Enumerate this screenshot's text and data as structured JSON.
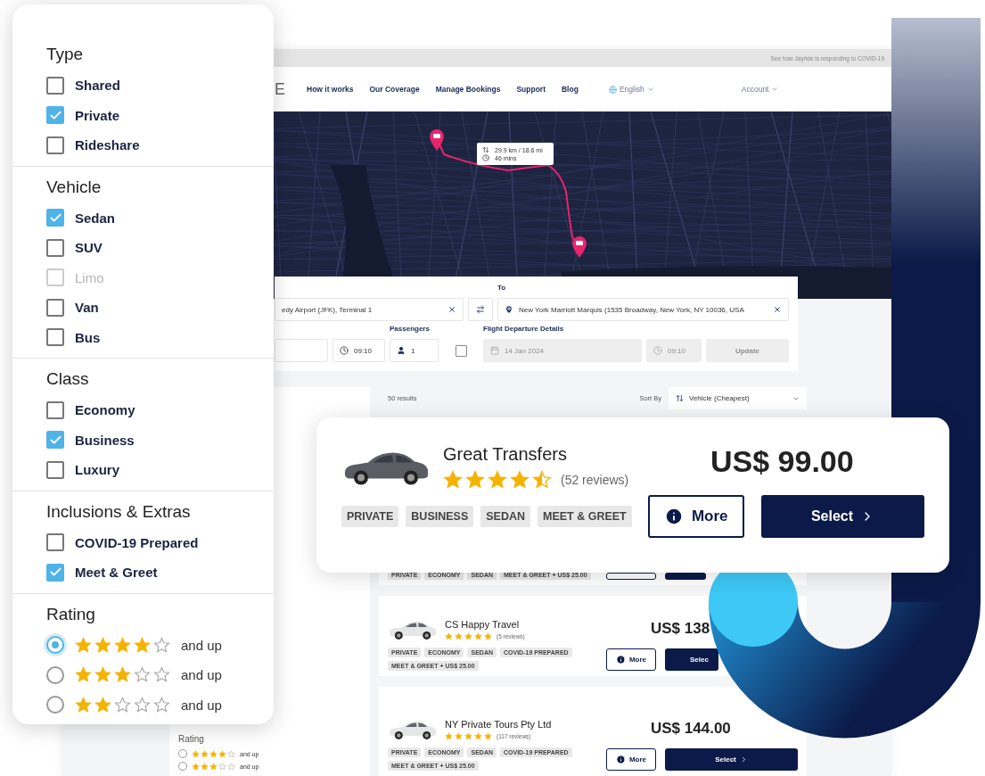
{
  "filters": {
    "sections": [
      {
        "title": "Type",
        "kind": "checkbox",
        "options": [
          {
            "label": "Shared",
            "checked": false,
            "disabled": false
          },
          {
            "label": "Private",
            "checked": true,
            "disabled": false
          },
          {
            "label": "Rideshare",
            "checked": false,
            "disabled": false
          }
        ]
      },
      {
        "title": "Vehicle",
        "kind": "checkbox",
        "options": [
          {
            "label": "Sedan",
            "checked": true,
            "disabled": false
          },
          {
            "label": "SUV",
            "checked": false,
            "disabled": false
          },
          {
            "label": "Limo",
            "checked": false,
            "disabled": true
          },
          {
            "label": "Van",
            "checked": false,
            "disabled": false
          },
          {
            "label": "Bus",
            "checked": false,
            "disabled": false
          }
        ]
      },
      {
        "title": "Class",
        "kind": "checkbox",
        "options": [
          {
            "label": "Economy",
            "checked": false,
            "disabled": false
          },
          {
            "label": "Business",
            "checked": true,
            "disabled": false
          },
          {
            "label": "Luxury",
            "checked": false,
            "disabled": false
          }
        ]
      },
      {
        "title": "Inclusions & Extras",
        "kind": "checkbox",
        "options": [
          {
            "label": "COVID-19 Prepared",
            "checked": false,
            "disabled": false
          },
          {
            "label": "Meet & Greet",
            "checked": true,
            "disabled": false
          }
        ]
      },
      {
        "title": "Rating",
        "kind": "radio",
        "options": [
          {
            "stars": 4,
            "label": "and up",
            "selected": true
          },
          {
            "stars": 3,
            "label": "and up",
            "selected": false
          },
          {
            "stars": 2,
            "label": "and up",
            "selected": false
          }
        ]
      }
    ]
  },
  "screen": {
    "notice": "See how Jayride is responding to COVID-19",
    "logo": "E",
    "nav": [
      "How it works",
      "Our Coverage",
      "Manage Bookings",
      "Support",
      "Blog"
    ],
    "language": "English",
    "account": "Account",
    "map": {
      "distance": "29.9 km / 18.6 mi",
      "duration": "46 mins"
    },
    "search": {
      "to_label": "To",
      "from_value": "edy Airport (JFK), Terminal 1",
      "to_value": "New York Marriott Marquis (1535 Broadway, New York, NY 10036, USA",
      "pickup_time": "09:10",
      "passengers_label": "Passengers",
      "passengers": "1",
      "flight_checked": false,
      "flight_label": "Flight Departure Details",
      "flight_disabled": true,
      "flight_date": "14 Jan 2024",
      "flight_time": "09:10",
      "update": "Update"
    },
    "sidebar": {
      "title": "Rating",
      "options": [
        {
          "stars": 4,
          "label": "and up",
          "selected": false
        },
        {
          "stars": 3,
          "label": "and up",
          "selected": false
        }
      ]
    },
    "results": {
      "count": "50 results",
      "sort_label": "Sort By",
      "sort_value": "Vehicle (Cheapest)",
      "cards": [
        {
          "tags": [
            "PRIVATE",
            "ECONOMY",
            "SEDAN",
            "MEET & GREET + US$ 25.00"
          ]
        },
        {
          "name": "CS Happy Travel",
          "stars": 5,
          "reviews": "(5 reviews)",
          "price": "US$ 138",
          "tags": [
            "PRIVATE",
            "ECONOMY",
            "SEDAN",
            "COVID-19 PREPARED",
            "MEET & GREET + US$ 25.00"
          ],
          "more": "More",
          "select": "Selec"
        },
        {
          "name": "NY Private Tours Pty Ltd",
          "stars": 5,
          "reviews": "(117 reviews)",
          "price": "US$ 144.00",
          "tags": [
            "PRIVATE",
            "ECONOMY",
            "SEDAN",
            "COVID-19 PREPARED",
            "MEET & GREET + US$ 25.00"
          ],
          "more": "More",
          "select": "Select"
        }
      ]
    }
  },
  "featured": {
    "name": "Great Transfers",
    "stars": 4.5,
    "reviews": "(52 reviews)",
    "tags": [
      "PRIVATE",
      "BUSINESS",
      "SEDAN",
      "MEET & GREET"
    ],
    "price": "US$ 99.00",
    "more": "More",
    "select": "Select"
  }
}
